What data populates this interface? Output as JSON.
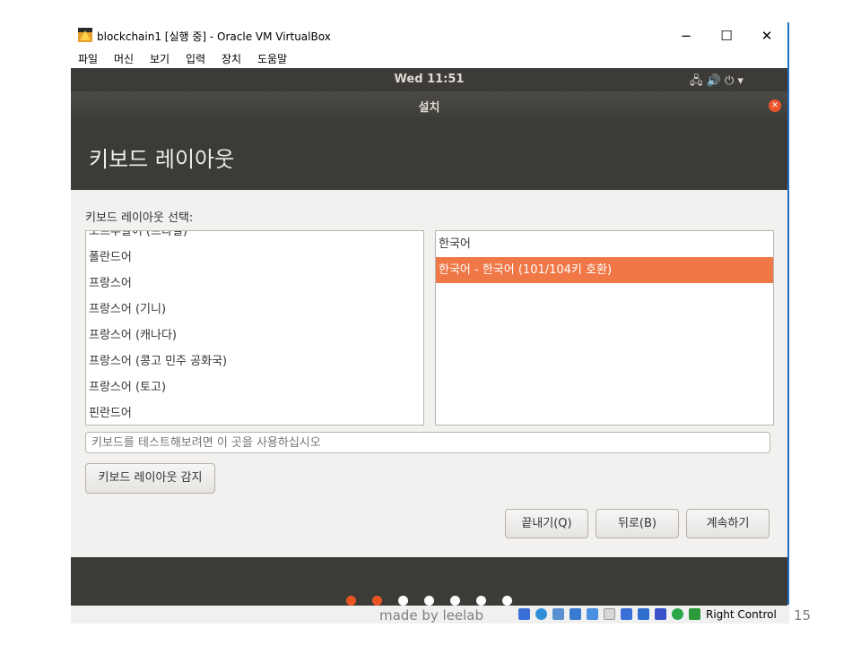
{
  "window": {
    "title": "blockchain1 [실행 중] - Oracle VM VirtualBox",
    "minimize": "−",
    "maximize": "☐",
    "close": "✕"
  },
  "menu": [
    "파일",
    "머신",
    "보기",
    "입력",
    "장치",
    "도움말"
  ],
  "guest": {
    "clock": "Wed 11:51",
    "tray": "🖧  🔊  ⏻ ▾",
    "dialog_title": "설치",
    "page_title": "키보드 레이아웃",
    "select_label": "키보드 레이아웃 선택:",
    "layouts": [
      "포르투갈어 (브라질)",
      "폴란드어",
      "프랑스어",
      "프랑스어 (기니)",
      "프랑스어 (캐나다)",
      "프랑스어 (콩고 민주 공화국)",
      "프랑스어 (토고)",
      "핀란드어"
    ],
    "variants": [
      "한국어",
      "한국어 - 한국어 (101/104키 호환)"
    ],
    "selected_variant_index": 1,
    "test_placeholder": "키보드를 테스트해보려면 이 곳을 사용하십시오",
    "detect_button": "키보드 레이아웃 감지",
    "quit_button": "끝내기(Q)",
    "back_button": "뒤로(B)",
    "continue_button": "계속하기",
    "progress": {
      "steps_total": 7,
      "steps_done": 2
    }
  },
  "status": {
    "host_key": "Right Control"
  },
  "slide": {
    "watermark": "made by leelab",
    "page_number": "15"
  },
  "colors": {
    "accent": "#f07746",
    "guest_bg": "#3c3b37",
    "dot_active": "#e95420",
    "dot_inactive": "#ffffff"
  }
}
